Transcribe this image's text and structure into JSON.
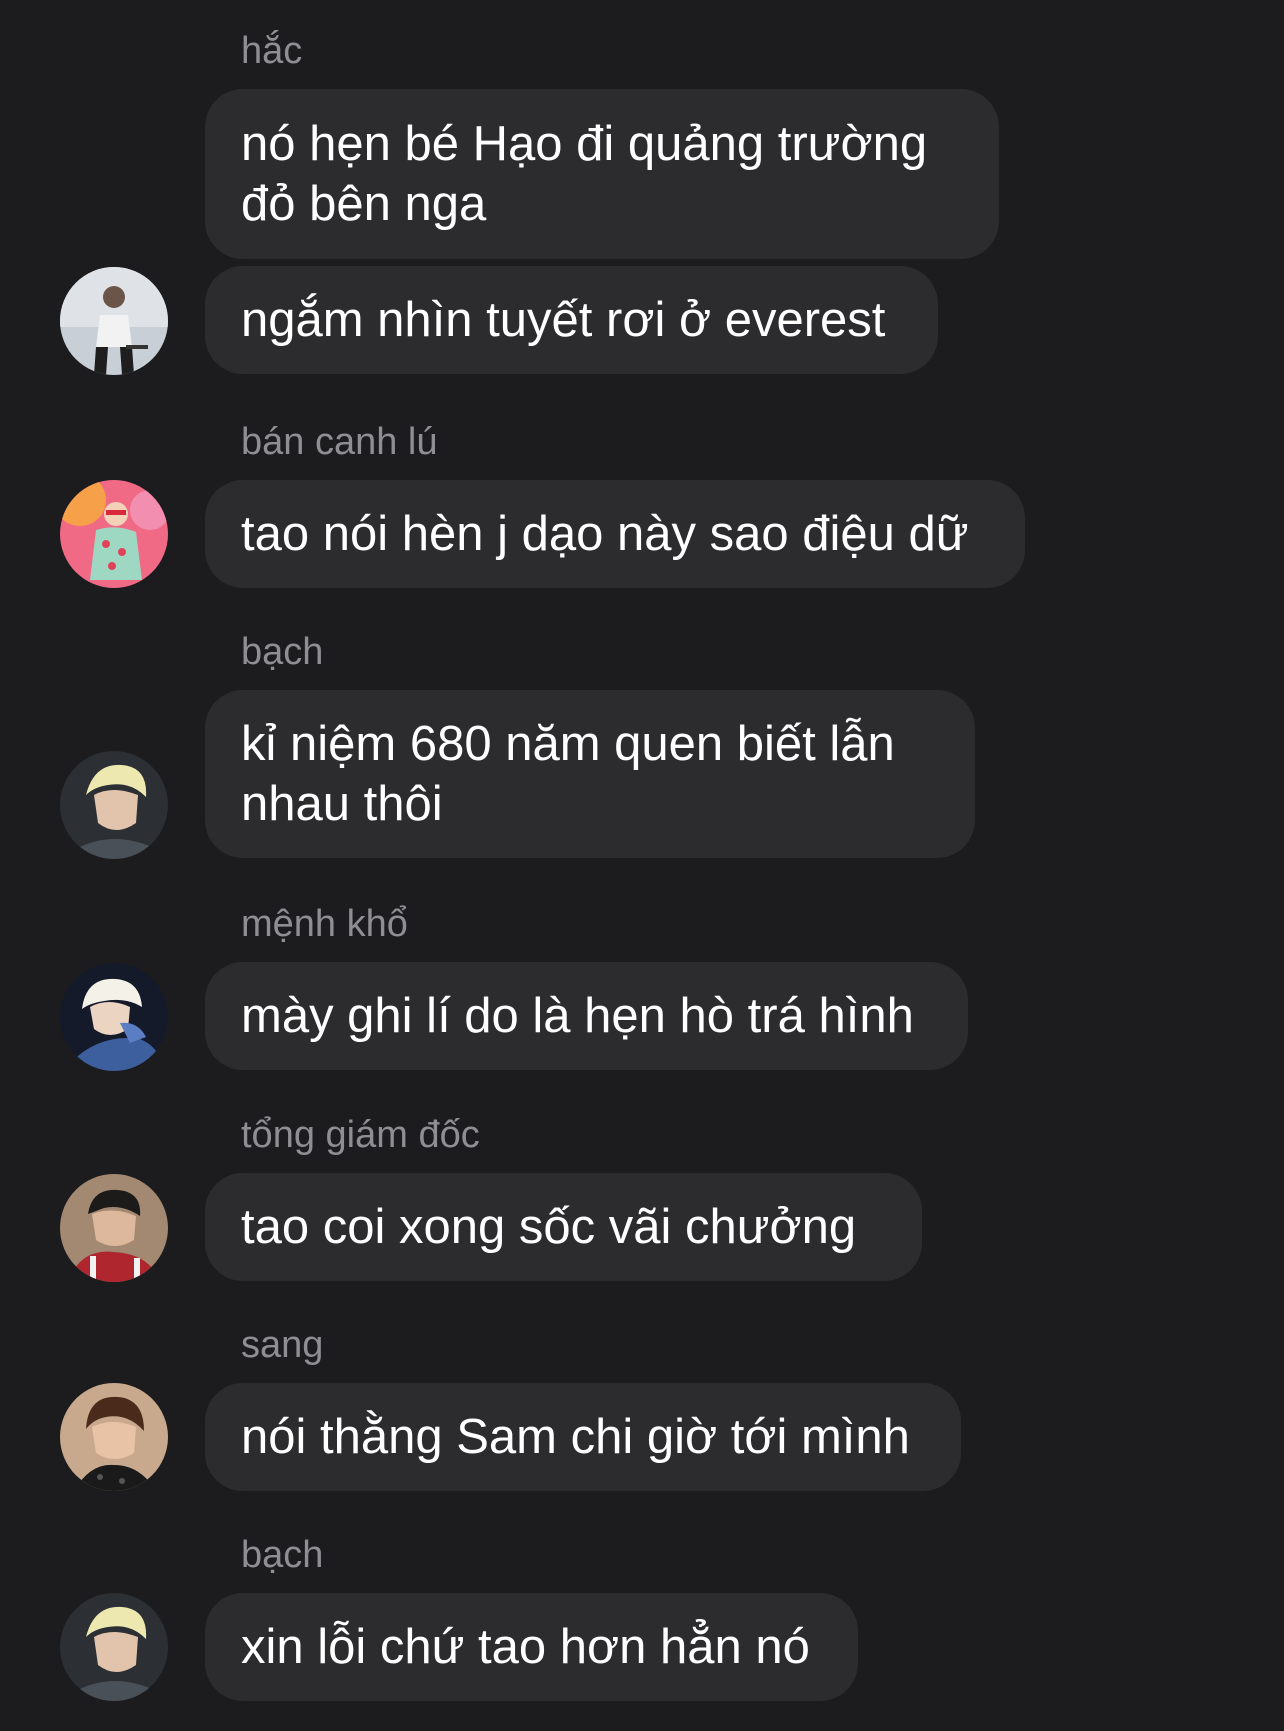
{
  "messages": [
    {
      "sender": "hắc",
      "bubbles": [
        [
          "nó hẹn bé Hạo đi quảng trường",
          "đỏ bên nga"
        ],
        [
          "ngắm nhìn tuyết rơi ở everest"
        ]
      ]
    },
    {
      "sender": "bán canh lú",
      "bubbles": [
        [
          "tao nói hèn j dạo này sao điệu dữ"
        ]
      ]
    },
    {
      "sender": "bạch",
      "bubbles": [
        [
          "kỉ niệm 680 năm quen biết lẫn",
          "nhau thôi"
        ]
      ]
    },
    {
      "sender": "mệnh khổ",
      "bubbles": [
        [
          "mày ghi lí do là hẹn hò trá hình"
        ]
      ]
    },
    {
      "sender": "tổng giám đốc",
      "bubbles": [
        [
          "tao coi xong sốc vãi chưởng"
        ]
      ]
    },
    {
      "sender": "sang",
      "bubbles": [
        [
          "nói thằng Sam chi giờ tới mình"
        ]
      ]
    },
    {
      "sender": "bạch",
      "bubbles": [
        [
          "xin lỗi chứ tao hơn hẳn nó"
        ]
      ]
    }
  ]
}
